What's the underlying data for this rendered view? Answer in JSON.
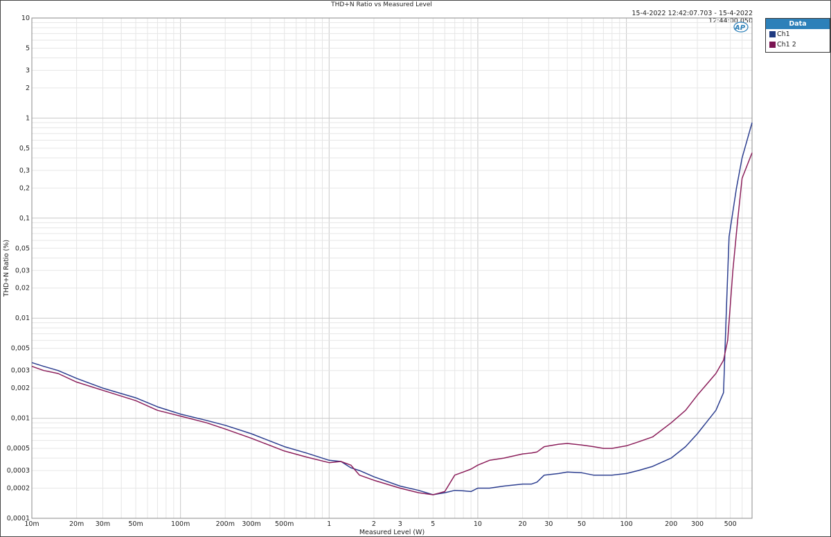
{
  "chart_data": {
    "type": "line",
    "title": "THD+N Ratio vs Measured Level",
    "subtitle": "15-4-2022 12:42:07.703 - 15-4-2022 12:44:00.050",
    "xlabel": "Measured Level (W)",
    "ylabel": "THD+N Ratio (%)",
    "xscale": "log",
    "yscale": "log",
    "xlim": [
      0.01,
      700
    ],
    "ylim": [
      0.0001,
      10
    ],
    "grid": true,
    "legend_title": "Data",
    "legend_position": "right",
    "x_ticks": [
      {
        "v": 0.01,
        "label": "10m"
      },
      {
        "v": 0.02,
        "label": "20m"
      },
      {
        "v": 0.03,
        "label": "30m"
      },
      {
        "v": 0.05,
        "label": "50m"
      },
      {
        "v": 0.1,
        "label": "100m"
      },
      {
        "v": 0.2,
        "label": "200m"
      },
      {
        "v": 0.3,
        "label": "300m"
      },
      {
        "v": 0.5,
        "label": "500m"
      },
      {
        "v": 1,
        "label": "1"
      },
      {
        "v": 2,
        "label": "2"
      },
      {
        "v": 3,
        "label": "3"
      },
      {
        "v": 5,
        "label": "5"
      },
      {
        "v": 10,
        "label": "10"
      },
      {
        "v": 20,
        "label": "20"
      },
      {
        "v": 30,
        "label": "30"
      },
      {
        "v": 50,
        "label": "50"
      },
      {
        "v": 100,
        "label": "100"
      },
      {
        "v": 200,
        "label": "200"
      },
      {
        "v": 300,
        "label": "300"
      },
      {
        "v": 500,
        "label": "500"
      }
    ],
    "y_ticks": [
      {
        "v": 10,
        "label": "10"
      },
      {
        "v": 5,
        "label": "5"
      },
      {
        "v": 3,
        "label": "3"
      },
      {
        "v": 2,
        "label": "2"
      },
      {
        "v": 1,
        "label": "1"
      },
      {
        "v": 0.5,
        "label": "0,5"
      },
      {
        "v": 0.3,
        "label": "0,3"
      },
      {
        "v": 0.2,
        "label": "0,2"
      },
      {
        "v": 0.1,
        "label": "0,1"
      },
      {
        "v": 0.05,
        "label": "0,05"
      },
      {
        "v": 0.03,
        "label": "0,03"
      },
      {
        "v": 0.02,
        "label": "0,02"
      },
      {
        "v": 0.01,
        "label": "0,01"
      },
      {
        "v": 0.005,
        "label": "0,005"
      },
      {
        "v": 0.003,
        "label": "0,003"
      },
      {
        "v": 0.002,
        "label": "0,002"
      },
      {
        "v": 0.001,
        "label": "0,001"
      },
      {
        "v": 0.0005,
        "label": "0,0005"
      },
      {
        "v": 0.0003,
        "label": "0,0003"
      },
      {
        "v": 0.0002,
        "label": "0,0002"
      },
      {
        "v": 0.0001,
        "label": "0,0001"
      }
    ],
    "series": [
      {
        "name": "Ch1",
        "color": "#2b3d8f",
        "x": [
          0.01,
          0.012,
          0.015,
          0.02,
          0.03,
          0.05,
          0.07,
          0.1,
          0.15,
          0.2,
          0.3,
          0.5,
          0.7,
          1,
          1.2,
          1.4,
          1.6,
          2,
          3,
          4,
          5,
          6,
          7,
          8,
          9,
          10,
          12,
          15,
          20,
          23,
          25,
          28,
          35,
          40,
          50,
          60,
          70,
          80,
          100,
          120,
          150,
          200,
          250,
          300,
          400,
          450,
          470,
          490,
          550,
          600,
          700
        ],
        "y": [
          0.0036,
          0.0033,
          0.003,
          0.0025,
          0.002,
          0.0016,
          0.0013,
          0.0011,
          0.00095,
          0.00085,
          0.0007,
          0.00052,
          0.00045,
          0.00038,
          0.00037,
          0.00032,
          0.0003,
          0.00026,
          0.00021,
          0.00019,
          0.000172,
          0.00018,
          0.00019,
          0.000188,
          0.000185,
          0.0002,
          0.0002,
          0.00021,
          0.00022,
          0.00022,
          0.00023,
          0.00027,
          0.00028,
          0.00029,
          0.000285,
          0.00027,
          0.00027,
          0.00027,
          0.00028,
          0.0003,
          0.00033,
          0.0004,
          0.00052,
          0.0007,
          0.0012,
          0.0018,
          0.012,
          0.065,
          0.2,
          0.4,
          0.9
        ]
      },
      {
        "name": "Ch1 2",
        "color": "#8b1e5a",
        "x": [
          0.01,
          0.012,
          0.015,
          0.02,
          0.03,
          0.05,
          0.07,
          0.1,
          0.15,
          0.2,
          0.3,
          0.5,
          0.7,
          1,
          1.2,
          1.4,
          1.6,
          2,
          3,
          4,
          5,
          6,
          7,
          8,
          9,
          10,
          12,
          15,
          20,
          23,
          25,
          28,
          35,
          40,
          50,
          60,
          70,
          80,
          100,
          120,
          150,
          200,
          250,
          300,
          400,
          450,
          480,
          520,
          560,
          600,
          700
        ],
        "y": [
          0.0033,
          0.003,
          0.0028,
          0.0023,
          0.0019,
          0.0015,
          0.0012,
          0.00105,
          0.0009,
          0.00078,
          0.00063,
          0.00047,
          0.00041,
          0.00036,
          0.00037,
          0.00034,
          0.00027,
          0.00024,
          0.0002,
          0.00018,
          0.000172,
          0.000185,
          0.00027,
          0.00029,
          0.00031,
          0.00034,
          0.00038,
          0.0004,
          0.00044,
          0.00045,
          0.00046,
          0.00052,
          0.00055,
          0.00056,
          0.00054,
          0.00052,
          0.0005,
          0.0005,
          0.00053,
          0.00058,
          0.00065,
          0.0009,
          0.0012,
          0.0017,
          0.0028,
          0.0038,
          0.006,
          0.03,
          0.095,
          0.25,
          0.45
        ]
      }
    ]
  }
}
